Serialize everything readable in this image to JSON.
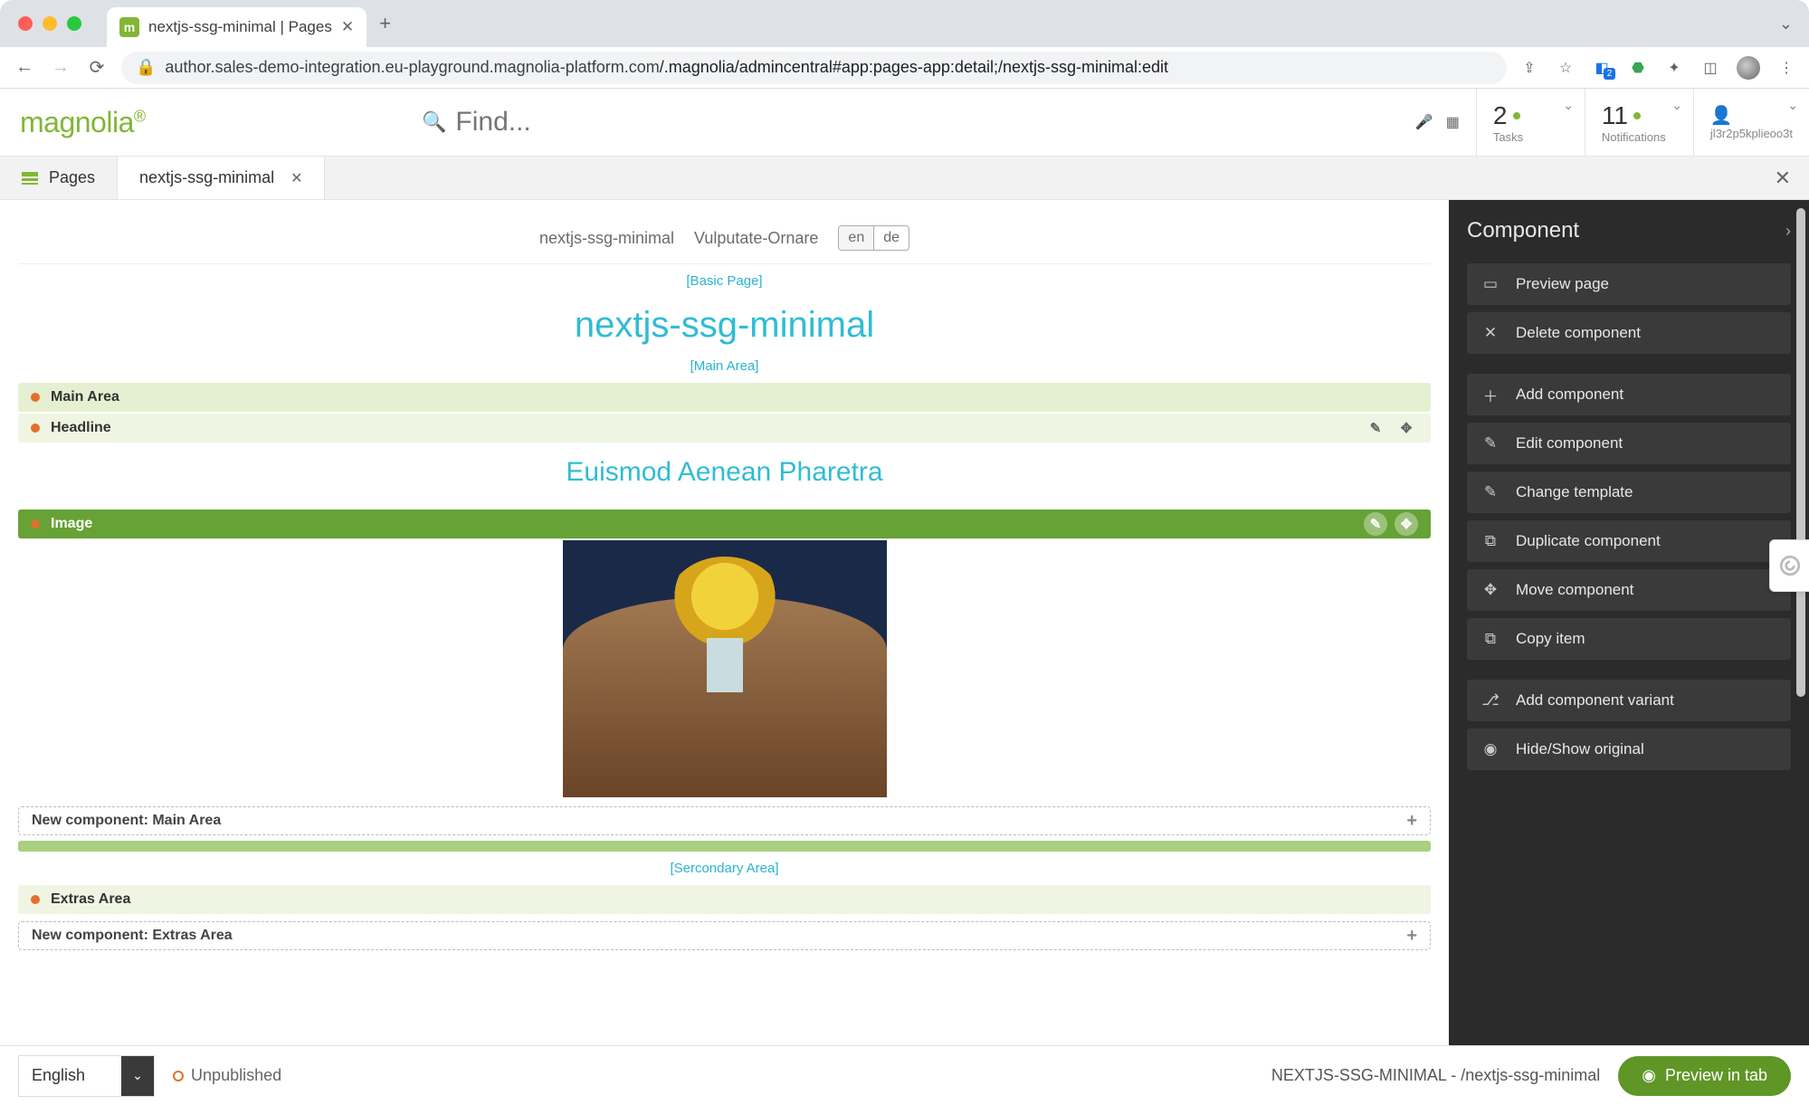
{
  "browser": {
    "tab_title": "nextjs-ssg-minimal | Pages",
    "url_host": "author.sales-demo-integration.eu-playground.magnolia-platform.com",
    "url_path": "/.magnolia/admincentral#app:pages-app:detail;/nextjs-ssg-minimal:edit",
    "ext_badge": "2"
  },
  "header": {
    "logo_text": "magnolia",
    "search_placeholder": "Find...",
    "tasks_count": "2",
    "tasks_label": "Tasks",
    "notifications_count": "11",
    "notifications_label": "Notifications",
    "username": "jl3r2p5kplieoo3t"
  },
  "tabs": {
    "main": "Pages",
    "active": "nextjs-ssg-minimal"
  },
  "page_header": {
    "crumb1": "nextjs-ssg-minimal",
    "crumb2": "Vulputate-Ornare",
    "lang_en": "en",
    "lang_de": "de"
  },
  "editor": {
    "basic_page": "[Basic Page]",
    "title": "nextjs-ssg-minimal",
    "main_area_label": "[Main Area]",
    "main_area_bar": "Main Area",
    "headline_bar": "Headline",
    "headline_text": "Euismod Aenean Pharetra",
    "image_bar": "Image",
    "new_main": "New component: Main Area",
    "secondary_label": "[Sercondary Area]",
    "extras_bar": "Extras Area",
    "new_extras": "New component: Extras Area"
  },
  "panel": {
    "title": "Component",
    "actions": [
      "Preview page",
      "Delete component",
      "Add component",
      "Edit component",
      "Change template",
      "Duplicate component",
      "Move component",
      "Copy item",
      "Add component variant",
      "Hide/Show original"
    ]
  },
  "footer": {
    "language": "English",
    "status": "Unpublished",
    "path": "NEXTJS-SSG-MINIMAL - /nextjs-ssg-minimal",
    "preview": "Preview in tab"
  }
}
